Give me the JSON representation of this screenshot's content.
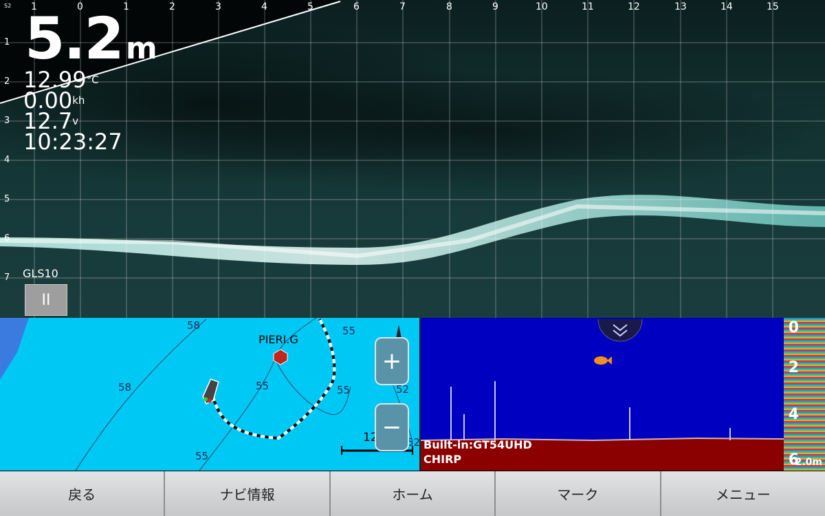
{
  "sonar": {
    "corner_tag": "S2",
    "depth_value": "5.2",
    "depth_unit": "m",
    "water_temp": "12.99",
    "water_temp_unit": "°C",
    "speed": "0.00",
    "speed_unit": "kh",
    "voltage": "12.7",
    "voltage_unit": "v",
    "time": "10:23:27",
    "source": "GLS10",
    "pause_label": "II",
    "x_ticks": [
      "1",
      "0",
      "1",
      "2",
      "3",
      "4",
      "5",
      "6",
      "7",
      "8",
      "9",
      "10",
      "11",
      "12",
      "13",
      "14",
      "15"
    ],
    "y_ticks": [
      "1",
      "2",
      "3",
      "4",
      "5",
      "6",
      "7"
    ],
    "colors": {
      "return": "#bff7f0",
      "water": "#153636"
    }
  },
  "map": {
    "waypoint_label": "PIERI.G",
    "scale_label": "12m",
    "zoom_in": "+",
    "zoom_out": "−",
    "depth_labels": [
      "58",
      "58",
      "55",
      "55",
      "55",
      "52",
      "52",
      "55"
    ],
    "colors": {
      "water": "#00c8f4",
      "land": "#3b7be0",
      "route": "#ffffff"
    }
  },
  "echo": {
    "scale": [
      "0",
      "2",
      "4",
      "6"
    ],
    "zoom_label": "2.0m",
    "source_line1": "Built-in:GT54UHD",
    "source_line2": "CHIRP",
    "colors": {
      "water": "#0000c0",
      "bottom": "#8b0000"
    }
  },
  "toolbar": {
    "back": "戻る",
    "nav_info": "ナビ情報",
    "home": "ホーム",
    "mark": "マーク",
    "menu": "メニュー"
  }
}
